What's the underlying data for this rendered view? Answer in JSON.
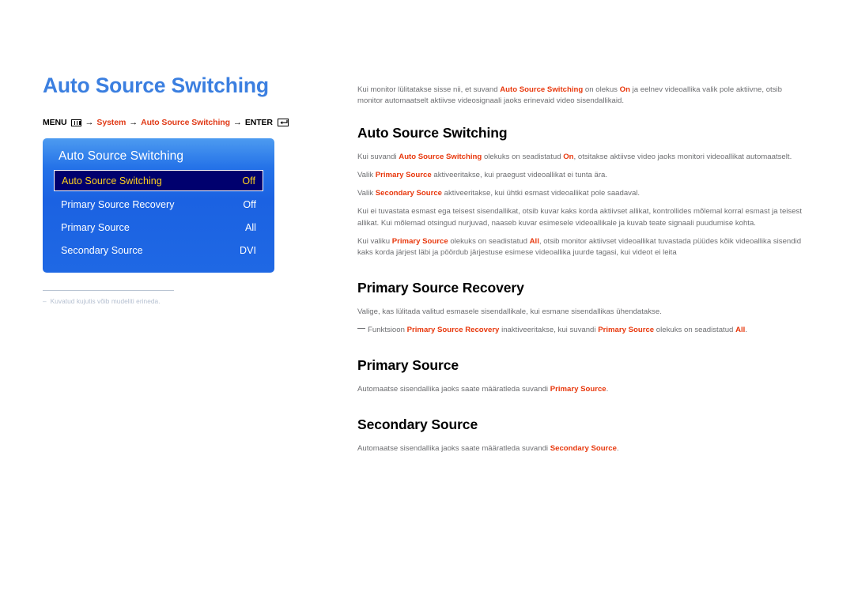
{
  "page": {
    "title": "Auto Source Switching"
  },
  "breadcrumb": {
    "menu_label": "MENU",
    "menu_icon": "menu-bars-icon",
    "arrow": "→",
    "item_system": "System",
    "item_auto_source_switching": "Auto Source Switching",
    "enter_label": "ENTER",
    "enter_icon": "enter-key-icon"
  },
  "osd": {
    "title": "Auto Source Switching",
    "selected_index": 0,
    "colors": {
      "panel_top": "#4d9bf0",
      "panel_bottom": "#1f68e4",
      "selected_bg": "#00006e",
      "selected_text": "#ffd21e",
      "row_text": "#ffffff"
    },
    "rows": [
      {
        "label": "Auto Source Switching",
        "value": "Off"
      },
      {
        "label": "Primary Source Recovery",
        "value": "Off"
      },
      {
        "label": "Primary Source",
        "value": "All"
      },
      {
        "label": "Secondary Source",
        "value": "DVI"
      }
    ]
  },
  "footnote": {
    "dash": "–",
    "text": "Kuvatud kujutis võib mudeliti erineda."
  },
  "intro": {
    "part1": "Kui monitor lülitatakse sisse nii, et suvand ",
    "bold1": "Auto Source Switching",
    "part2": " on olekus ",
    "bold2": "On",
    "part3": " ja eelnev videoallika valik pole aktiivne, otsib monitor automaatselt aktiivse videosignaali jaoks erinevaid video sisendallikaid."
  },
  "sections": [
    {
      "heading": "Auto Source Switching",
      "paragraphs": [
        {
          "segments": [
            {
              "text": "Kui suvandi ",
              "bold": false
            },
            {
              "text": "Auto Source Switching",
              "bold": true
            },
            {
              "text": " olekuks on seadistatud ",
              "bold": false
            },
            {
              "text": "On",
              "bold": true
            },
            {
              "text": ", otsitakse aktiivse video jaoks monitori videoallikat automaatselt.",
              "bold": false
            }
          ]
        },
        {
          "segments": [
            {
              "text": "Valik ",
              "bold": false
            },
            {
              "text": "Primary Source",
              "bold": true
            },
            {
              "text": " aktiveeritakse, kui praegust videoallikat ei tunta ära.",
              "bold": false
            }
          ]
        },
        {
          "segments": [
            {
              "text": "Valik ",
              "bold": false
            },
            {
              "text": "Secondary Source",
              "bold": true
            },
            {
              "text": " aktiveeritakse, kui ühtki esmast videoallikat pole saadaval.",
              "bold": false
            }
          ]
        },
        {
          "segments": [
            {
              "text": "Kui ei tuvastata esmast ega teisest sisendallikat, otsib kuvar kaks korda aktiivset allikat, kontrollides mõlemal korral esmast ja teisest allikat. Kui mõlemad otsingud nurjuvad, naaseb kuvar esimesele videoallikale ja kuvab teate signaali puudumise kohta.",
              "bold": false
            }
          ]
        },
        {
          "segments": [
            {
              "text": "Kui valiku ",
              "bold": false
            },
            {
              "text": "Primary Source",
              "bold": true
            },
            {
              "text": " olekuks on seadistatud ",
              "bold": false
            },
            {
              "text": "All",
              "bold": true
            },
            {
              "text": ", otsib monitor aktiivset videoallikat tuvastada püüdes kõik videoallika sisendid kaks korda järjest läbi ja pöördub järjestuse esimese videoallika juurde tagasi, kui videot ei leita",
              "bold": false
            }
          ]
        }
      ]
    },
    {
      "heading": "Primary Source Recovery",
      "paragraphs": [
        {
          "segments": [
            {
              "text": "Valige, kas lülitada valitud esmasele sisendallikale, kui esmane sisendallikas ühendatakse.",
              "bold": false
            }
          ]
        },
        {
          "note": true,
          "segments": [
            {
              "text": "Funktsioon ",
              "bold": false
            },
            {
              "text": "Primary Source Recovery",
              "bold": true
            },
            {
              "text": " inaktiveeritakse, kui suvandi ",
              "bold": false
            },
            {
              "text": "Primary Source",
              "bold": true
            },
            {
              "text": " olekuks on seadistatud ",
              "bold": false
            },
            {
              "text": "All",
              "bold": true
            },
            {
              "text": ".",
              "bold": false
            }
          ]
        }
      ]
    },
    {
      "heading": "Primary Source",
      "paragraphs": [
        {
          "segments": [
            {
              "text": "Automaatse sisendallika jaoks saate määratleda suvandi ",
              "bold": false
            },
            {
              "text": "Primary Source",
              "bold": true
            },
            {
              "text": ".",
              "bold": false
            }
          ]
        }
      ]
    },
    {
      "heading": "Secondary Source",
      "paragraphs": [
        {
          "segments": [
            {
              "text": "Automaatse sisendallika jaoks saate määratleda suvandi ",
              "bold": false
            },
            {
              "text": "Secondary Source",
              "bold": true
            },
            {
              "text": ".",
              "bold": false
            }
          ]
        }
      ]
    }
  ]
}
